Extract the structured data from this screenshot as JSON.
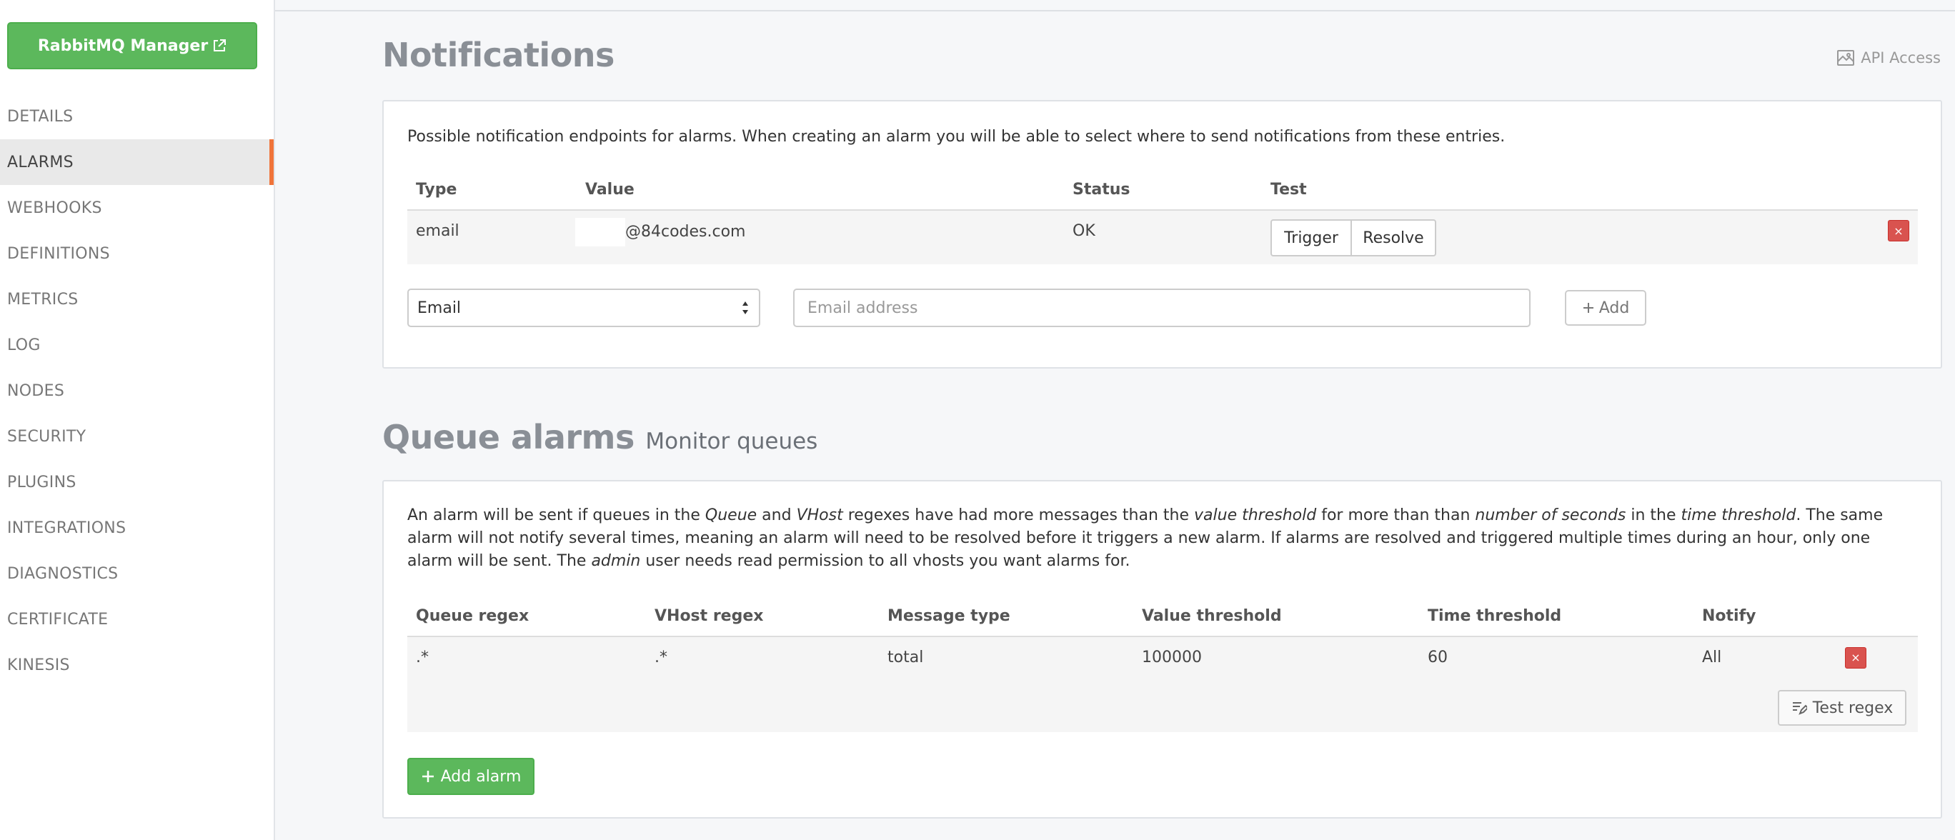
{
  "sidebar": {
    "manager_button": "RabbitMQ Manager",
    "items": [
      {
        "label": "DETAILS"
      },
      {
        "label": "ALARMS",
        "active": true
      },
      {
        "label": "WEBHOOKS"
      },
      {
        "label": "DEFINITIONS"
      },
      {
        "label": "METRICS"
      },
      {
        "label": "LOG"
      },
      {
        "label": "NODES"
      },
      {
        "label": "SECURITY"
      },
      {
        "label": "PLUGINS"
      },
      {
        "label": "INTEGRATIONS"
      },
      {
        "label": "DIAGNOSTICS"
      },
      {
        "label": "CERTIFICATE"
      },
      {
        "label": "KINESIS"
      }
    ]
  },
  "header": {
    "api_access": "API Access"
  },
  "notifications": {
    "title": "Notifications",
    "description": "Possible notification endpoints for alarms. When creating an alarm you will be able to select where to send notifications from these entries.",
    "columns": [
      "Type",
      "Value",
      "Status",
      "Test"
    ],
    "rows": [
      {
        "type": "email",
        "value": "@84codes.com",
        "status": "OK",
        "trigger": "Trigger",
        "resolve": "Resolve",
        "delete": "×"
      }
    ],
    "form": {
      "select_value": "Email",
      "input_placeholder": "Email address",
      "add_label": "Add"
    }
  },
  "queue_alarms": {
    "title": "Queue alarms",
    "subtitle": "Monitor queues",
    "description": {
      "p1": "An alarm will be sent if queues in the ",
      "queue": "Queue",
      "p2": " and ",
      "vhost": "VHost",
      "p3": " regexes have had more messages than the ",
      "value_threshold": "value threshold",
      "p4": " for more than than ",
      "seconds": "number of seconds",
      "p5": " in the ",
      "time_threshold": "time threshold",
      "p6": ". The same alarm will not notify several times, meaning an alarm will need to be resolved before it triggers a new alarm. If alarms are resolved and triggered multiple times during an hour, only one alarm will be sent. The ",
      "admin": "admin",
      "p7": " user needs read permission to all vhosts you want alarms for."
    },
    "columns": [
      "Queue regex",
      "VHost regex",
      "Message type",
      "Value threshold",
      "Time threshold",
      "Notify"
    ],
    "rows": [
      {
        "queue_regex": ".*",
        "vhost_regex": ".*",
        "message_type": "total",
        "value_threshold": "100000",
        "time_threshold": "60",
        "notify": "All",
        "delete": "×"
      }
    ],
    "test_regex_label": "Test regex",
    "add_alarm_label": "Add alarm"
  }
}
